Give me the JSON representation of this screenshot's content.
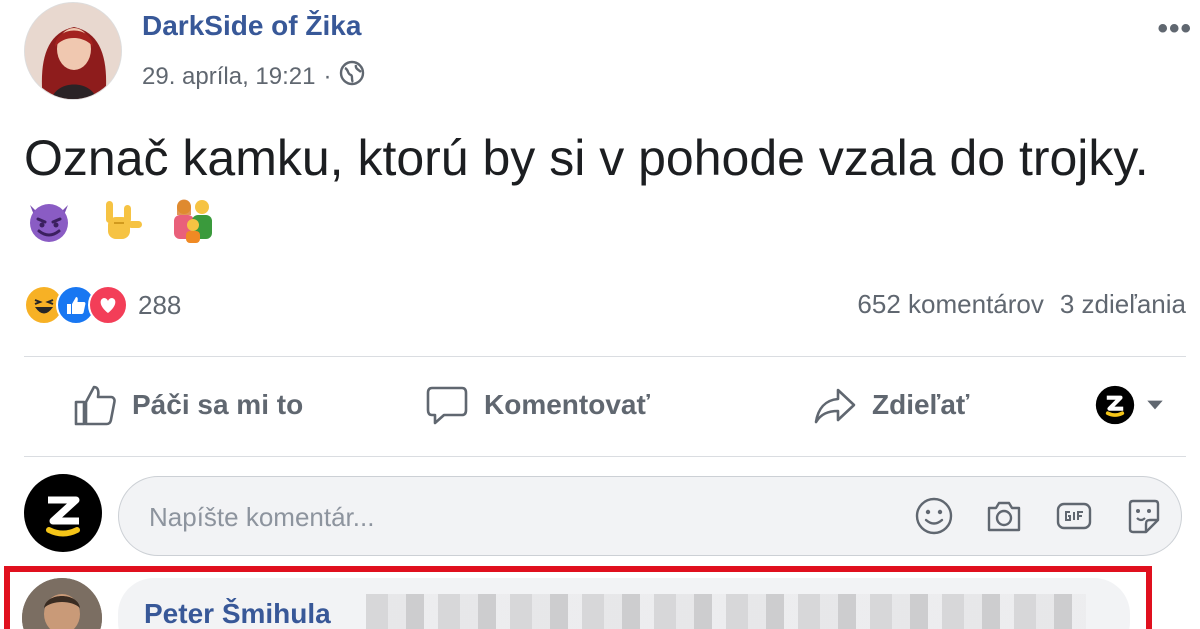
{
  "post": {
    "author": "DarkSide of Žika",
    "timestamp": "29. apríla, 19:21",
    "separator": "·",
    "privacy_icon": "globe-icon",
    "more_label": "•••",
    "text": "Označ kamku, ktorú by si v pohode vzala do trojky.",
    "emojis": [
      "smiling-devil-emoji",
      "love-you-gesture-emoji",
      "family-emoji"
    ]
  },
  "stats": {
    "reaction_icons": [
      "haha-icon",
      "like-icon",
      "love-icon"
    ],
    "reaction_count": "288",
    "comments": "652 komentárov",
    "shares": "3 zdieľania"
  },
  "actions": {
    "like": "Páči sa mi to",
    "comment": "Komentovať",
    "share": "Zdieľať"
  },
  "comment_box": {
    "placeholder": "Napíšte komentár...",
    "icons": [
      "emoji-icon",
      "camera-icon",
      "gif-icon",
      "sticker-icon"
    ]
  },
  "reply": {
    "author": "Peter Šmihula"
  },
  "colors": {
    "link_blue": "#385898",
    "highlight_red": "#e0101e",
    "secondary_text": "#606770"
  }
}
